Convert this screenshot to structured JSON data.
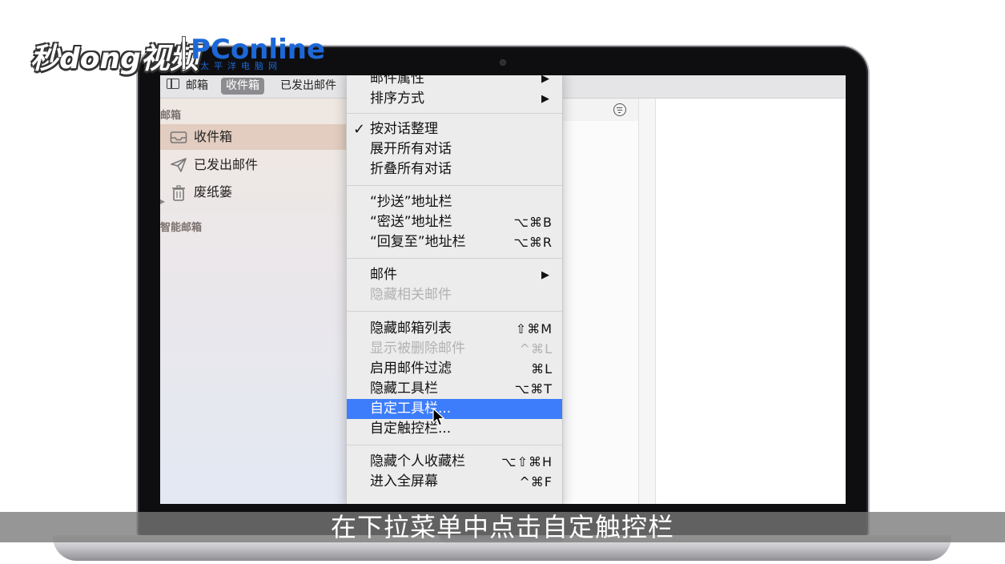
{
  "overlay": {
    "logo_text": "秒dong视频",
    "brand": "PConline",
    "brand_sub": "太平洋电脑网",
    "caption": "在下拉菜单中点击自定触控栏"
  },
  "toolbar": {
    "mailboxes_label": "邮箱",
    "inbox_tab": "收件箱",
    "sent_tab": "已发出邮件"
  },
  "sidebar": {
    "section_mailboxes": "邮箱",
    "items": [
      {
        "label": "收件箱",
        "icon": "inbox-tray-icon"
      },
      {
        "label": "已发出邮件",
        "icon": "paper-plane-icon"
      },
      {
        "label": "废纸篓",
        "icon": "trash-icon"
      }
    ],
    "section_smart": "智能邮箱"
  },
  "menu": {
    "items": [
      {
        "label": "邮件属性",
        "shortcut": "",
        "submenu": true
      },
      {
        "label": "排序方式",
        "shortcut": "",
        "submenu": true
      },
      {
        "label": "按对话整理",
        "shortcut": "",
        "checked": true
      },
      {
        "label": "展开所有对话",
        "shortcut": ""
      },
      {
        "label": "折叠所有对话",
        "shortcut": ""
      },
      {
        "label": "“抄送”地址栏",
        "shortcut": ""
      },
      {
        "label": "“密送”地址栏",
        "shortcut": "⌥⌘B"
      },
      {
        "label": "“回复至”地址栏",
        "shortcut": "⌥⌘R"
      },
      {
        "label": "邮件",
        "shortcut": "",
        "submenu": true
      },
      {
        "label": "隐藏相关邮件",
        "shortcut": "",
        "disabled": true
      },
      {
        "label": "隐藏邮箱列表",
        "shortcut": "⇧⌘M"
      },
      {
        "label": "显示被删除邮件",
        "shortcut": "^⌘L",
        "disabled": true
      },
      {
        "label": "启用邮件过滤",
        "shortcut": "⌘L"
      },
      {
        "label": "隐藏工具栏",
        "shortcut": "⌥⌘T"
      },
      {
        "label": "自定工具栏...",
        "shortcut": "",
        "highlighted": true
      },
      {
        "label": "自定触控栏...",
        "shortcut": ""
      },
      {
        "label": "隐藏个人收藏栏",
        "shortcut": "⌥⇧⌘H"
      },
      {
        "label": "进入全屏幕",
        "shortcut": "^⌘F"
      }
    ],
    "check_glyph": "✓",
    "arrow_glyph": "▶"
  },
  "colors": {
    "highlight": "#3d7dfb",
    "menu_bg": "#ececec",
    "sidebar_selected": "#e2cdc0",
    "brand_blue": "#1d68d8"
  }
}
